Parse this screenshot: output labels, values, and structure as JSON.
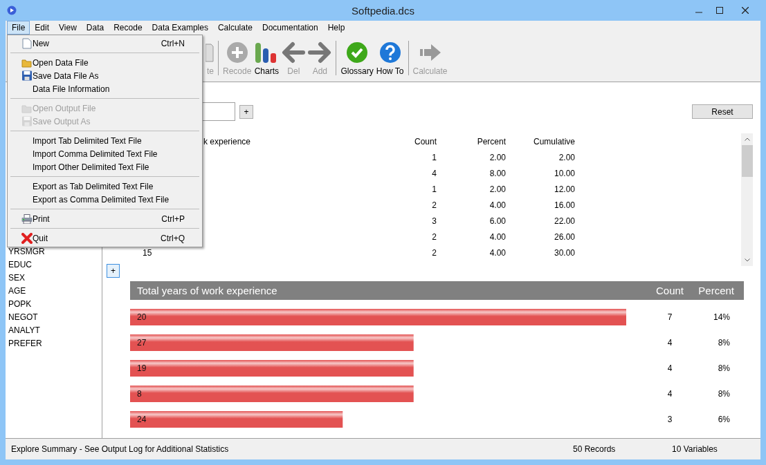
{
  "window": {
    "title": "Softpedia.dcs"
  },
  "menubar": [
    {
      "label": "File",
      "selected": true
    },
    {
      "label": "Edit",
      "selected": false
    },
    {
      "label": "View",
      "selected": false
    },
    {
      "label": "Data",
      "selected": false
    },
    {
      "label": "Recode",
      "selected": false
    },
    {
      "label": "Data Examples",
      "selected": false
    },
    {
      "label": "Calculate",
      "selected": false
    },
    {
      "label": "Documentation",
      "selected": false
    },
    {
      "label": "Help",
      "selected": false
    }
  ],
  "file_menu": [
    {
      "kind": "item",
      "label": "New",
      "shortcut": "Ctrl+N",
      "disabled": false
    },
    {
      "kind": "separator"
    },
    {
      "kind": "item",
      "label": "Open Data File",
      "disabled": false
    },
    {
      "kind": "item",
      "label": "Save Data File As",
      "disabled": false
    },
    {
      "kind": "item",
      "label": "Data File Information",
      "disabled": false
    },
    {
      "kind": "separator"
    },
    {
      "kind": "item",
      "label": "Open Output File",
      "disabled": true
    },
    {
      "kind": "item",
      "label": "Save Output As",
      "disabled": true
    },
    {
      "kind": "separator"
    },
    {
      "kind": "item",
      "label": "Import Tab Delimited Text File",
      "disabled": false
    },
    {
      "kind": "item",
      "label": "Import Comma Delimited Text File",
      "disabled": false
    },
    {
      "kind": "item",
      "label": "Import Other Delimited Text File",
      "disabled": false
    },
    {
      "kind": "separator"
    },
    {
      "kind": "item",
      "label": "Export as Tab Delimited Text File",
      "disabled": false
    },
    {
      "kind": "item",
      "label": "Export as Comma Delimited Text File",
      "disabled": false
    },
    {
      "kind": "separator"
    },
    {
      "kind": "item",
      "label": "Print",
      "shortcut": "Ctrl+P",
      "disabled": false
    },
    {
      "kind": "separator"
    },
    {
      "kind": "item",
      "label": "Quit",
      "shortcut": "Ctrl+Q",
      "disabled": false
    }
  ],
  "toolbar": [
    {
      "kind": "button",
      "label": "te",
      "disabled": true
    },
    {
      "kind": "separator"
    },
    {
      "kind": "button",
      "label": "Recode",
      "disabled": true
    },
    {
      "kind": "button",
      "label": "Charts",
      "disabled": false
    },
    {
      "kind": "button",
      "label": "Del",
      "disabled": true
    },
    {
      "kind": "button",
      "label": "Add",
      "disabled": true
    },
    {
      "kind": "separator"
    },
    {
      "kind": "button",
      "label": "Glossary",
      "disabled": false
    },
    {
      "kind": "button",
      "label": "How To",
      "disabled": false
    },
    {
      "kind": "separator"
    },
    {
      "kind": "button",
      "label": "Calculate",
      "disabled": true
    }
  ],
  "sidebar": {
    "items": [
      "YRSMGR",
      "EDUC",
      "SEX",
      "AGE",
      "POPK",
      "NEGOT",
      "ANALYT",
      "PREFER"
    ]
  },
  "add_button": "+",
  "reset_button": "Reset",
  "table": {
    "columns": [
      "k experience",
      "Count",
      "Percent",
      "Cumulative"
    ],
    "rows": [
      {
        "value": "",
        "count": "1",
        "percent": "2.00",
        "cumulative": "2.00"
      },
      {
        "value": "",
        "count": "4",
        "percent": "8.00",
        "cumulative": "10.00"
      },
      {
        "value": "",
        "count": "1",
        "percent": "2.00",
        "cumulative": "12.00"
      },
      {
        "value": "",
        "count": "2",
        "percent": "4.00",
        "cumulative": "16.00"
      },
      {
        "value": "",
        "count": "3",
        "percent": "6.00",
        "cumulative": "22.00"
      },
      {
        "value": "",
        "count": "2",
        "percent": "4.00",
        "cumulative": "26.00"
      },
      {
        "value": "15",
        "count": "2",
        "percent": "4.00",
        "cumulative": "30.00"
      }
    ]
  },
  "side_add_button": "+",
  "summary": {
    "title": "Total years of work experience",
    "percent_header": "Percent",
    "percents": [
      "14%",
      "8%",
      "8%",
      "8%",
      "6%"
    ],
    "chart_data": {
      "type": "bar",
      "orientation": "horizontal",
      "data_labels": true,
      "categories": [
        "20",
        "27",
        "19",
        "8",
        "24"
      ],
      "series": [
        {
          "name": "Count",
          "color": "#e35252",
          "values": [
            7,
            4,
            4,
            4,
            3
          ]
        }
      ]
    }
  },
  "status_bar": {
    "message": "Explore Summary  -  See Output Log for Additional Statistics",
    "records": "50 Records",
    "variables": "10 Variables"
  }
}
